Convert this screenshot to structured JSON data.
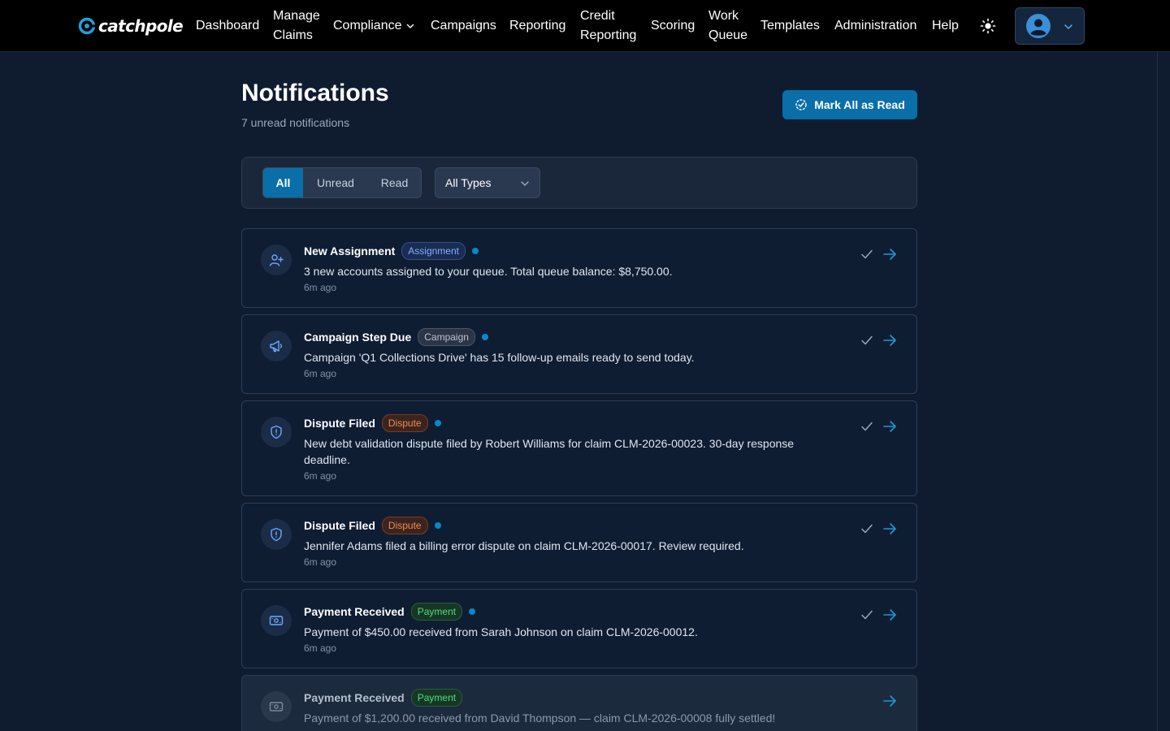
{
  "nav": {
    "logo_text": "catchpole",
    "items": [
      {
        "label": "Dashboard"
      },
      {
        "label": "Manage",
        "label2": "Claims"
      },
      {
        "label": "Compliance"
      },
      {
        "label": "Campaigns"
      },
      {
        "label": "Reporting"
      },
      {
        "label": "Credit",
        "label2": "Reporting"
      },
      {
        "label": "Scoring"
      },
      {
        "label": "Work",
        "label2": "Queue"
      },
      {
        "label": "Templates"
      },
      {
        "label": "Administration"
      },
      {
        "label": "Help"
      }
    ]
  },
  "header": {
    "title": "Notifications",
    "subtitle": "7 unread notifications",
    "mark_all_label": "Mark All as Read"
  },
  "filters": {
    "tabs": [
      "All",
      "Unread",
      "Read"
    ],
    "active_tab": "All",
    "type_select": "All Types"
  },
  "notifications": [
    {
      "title": "New Assignment",
      "badge": "Assignment",
      "message": "3 new accounts assigned to your queue. Total queue balance: $8,750.00.",
      "time": "6m ago"
    },
    {
      "title": "Campaign Step Due",
      "badge": "Campaign",
      "message": "Campaign 'Q1 Collections Drive' has 15 follow-up emails ready to send today.",
      "time": "6m ago"
    },
    {
      "title": "Dispute Filed",
      "badge": "Dispute",
      "message": "New debt validation dispute filed by Robert Williams for claim CLM-2026-00023. 30-day response deadline.",
      "time": "6m ago"
    },
    {
      "title": "Dispute Filed",
      "badge": "Dispute",
      "message": "Jennifer Adams filed a billing error dispute on claim CLM-2026-00017. Review required.",
      "time": "6m ago"
    },
    {
      "title": "Payment Received",
      "badge": "Payment",
      "message": "Payment of $450.00 received from Sarah Johnson on claim CLM-2026-00012.",
      "time": "6m ago"
    },
    {
      "title": "Payment Received",
      "badge": "Payment",
      "message": "Payment of $1,200.00 received from David Thompson — claim CLM-2026-00008 fully settled!",
      "time": ""
    }
  ],
  "colors": {
    "accent": "#0a6ea8",
    "background": "#0f1c30",
    "unread_dot": "#0b87c7"
  }
}
